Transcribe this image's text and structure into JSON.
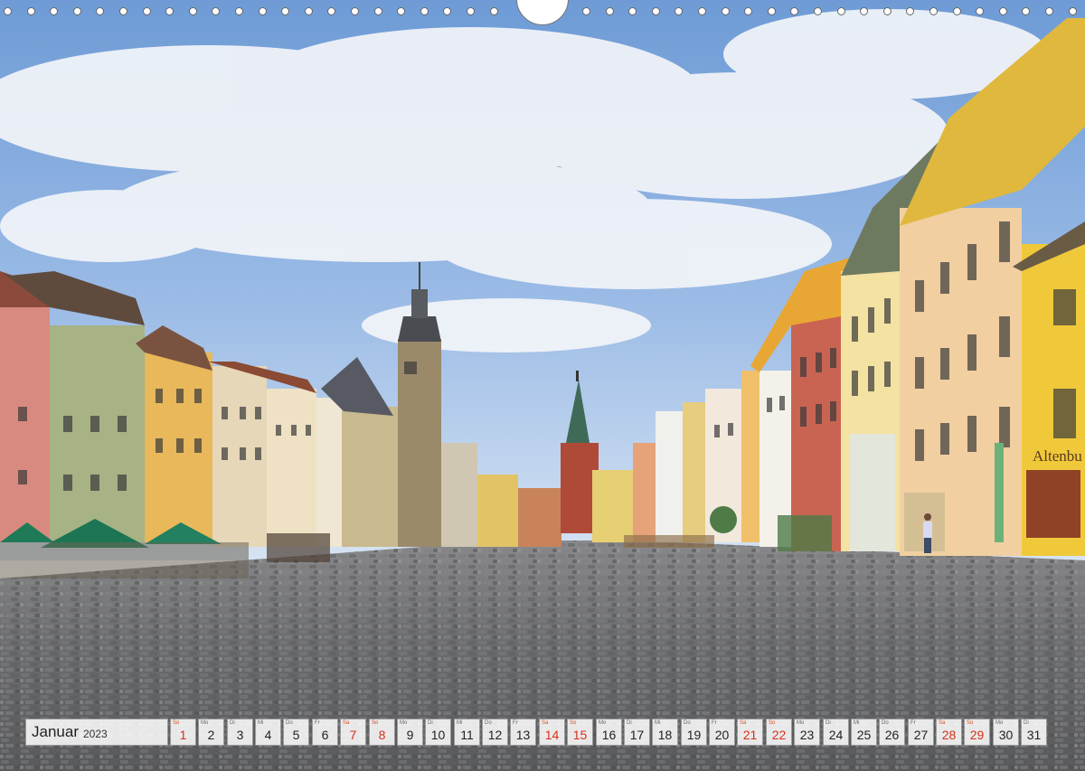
{
  "photo": {
    "subject": "old-town-market-square",
    "colors": {
      "sky_top": "#6e9bd6",
      "sky_low": "#bcd2ee",
      "cloud": "#f4f6fa",
      "cobble": "#6f6f70",
      "cobble_dark": "#4d4e50",
      "tower": "#9a8a6a",
      "church": "#b04a38",
      "yellow_house": "#e9c545",
      "umbrella": "#1f7a58"
    },
    "signs": {
      "sign_right": "Altenbu"
    }
  },
  "calendar": {
    "month": "Januar",
    "year": "2023",
    "weekend_color": "#d83018",
    "days": [
      {
        "abbr": "So",
        "num": "1",
        "weekend": true
      },
      {
        "abbr": "Mo",
        "num": "2",
        "weekend": false
      },
      {
        "abbr": "Di",
        "num": "3",
        "weekend": false
      },
      {
        "abbr": "Mi",
        "num": "4",
        "weekend": false
      },
      {
        "abbr": "Do",
        "num": "5",
        "weekend": false
      },
      {
        "abbr": "Fr",
        "num": "6",
        "weekend": false
      },
      {
        "abbr": "Sa",
        "num": "7",
        "weekend": true
      },
      {
        "abbr": "So",
        "num": "8",
        "weekend": true
      },
      {
        "abbr": "Mo",
        "num": "9",
        "weekend": false
      },
      {
        "abbr": "Di",
        "num": "10",
        "weekend": false
      },
      {
        "abbr": "Mi",
        "num": "11",
        "weekend": false
      },
      {
        "abbr": "Do",
        "num": "12",
        "weekend": false
      },
      {
        "abbr": "Fr",
        "num": "13",
        "weekend": false
      },
      {
        "abbr": "Sa",
        "num": "14",
        "weekend": true
      },
      {
        "abbr": "So",
        "num": "15",
        "weekend": true
      },
      {
        "abbr": "Mo",
        "num": "16",
        "weekend": false
      },
      {
        "abbr": "Di",
        "num": "17",
        "weekend": false
      },
      {
        "abbr": "Mi",
        "num": "18",
        "weekend": false
      },
      {
        "abbr": "Do",
        "num": "19",
        "weekend": false
      },
      {
        "abbr": "Fr",
        "num": "20",
        "weekend": false
      },
      {
        "abbr": "Sa",
        "num": "21",
        "weekend": true
      },
      {
        "abbr": "So",
        "num": "22",
        "weekend": true
      },
      {
        "abbr": "Mo",
        "num": "23",
        "weekend": false
      },
      {
        "abbr": "Di",
        "num": "24",
        "weekend": false
      },
      {
        "abbr": "Mi",
        "num": "25",
        "weekend": false
      },
      {
        "abbr": "Do",
        "num": "26",
        "weekend": false
      },
      {
        "abbr": "Fr",
        "num": "27",
        "weekend": false
      },
      {
        "abbr": "Sa",
        "num": "28",
        "weekend": true
      },
      {
        "abbr": "So",
        "num": "29",
        "weekend": true
      },
      {
        "abbr": "Mo",
        "num": "30",
        "weekend": false
      },
      {
        "abbr": "Di",
        "num": "31",
        "weekend": false
      }
    ]
  }
}
